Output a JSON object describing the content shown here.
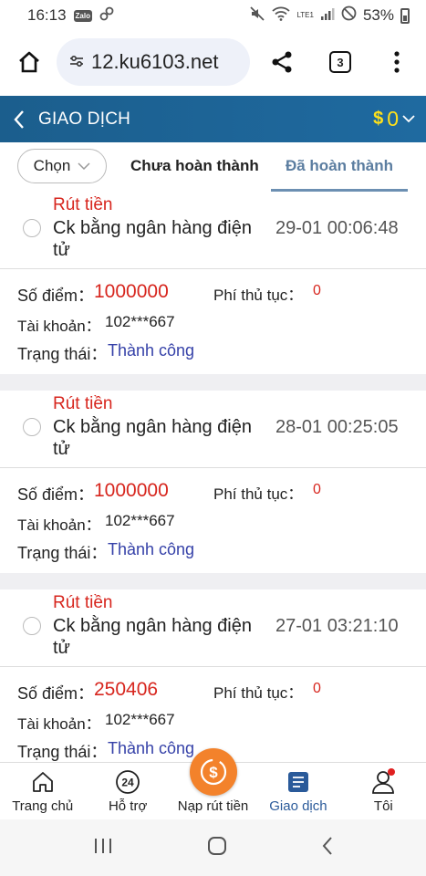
{
  "status_bar": {
    "time": "16:13",
    "zalo": "Zalo",
    "battery": "53%",
    "network": "LTE1"
  },
  "browser": {
    "url": "12.ku6103.net",
    "tab_count": "3"
  },
  "header": {
    "title": "GIAO DỊCH",
    "currency": "$",
    "balance": "0"
  },
  "tabs": {
    "select_label": "Chọn",
    "pending_label": "Chưa hoàn thành",
    "done_label": "Đã hoàn thành"
  },
  "labels": {
    "points": "Số điểm：",
    "fee": "Phí thủ tục：",
    "account": "Tài khoản：",
    "status": "Trạng thái："
  },
  "transactions": [
    {
      "type": "Rút tiền",
      "method": "Ck bằng ngân hàng điện tử",
      "time": "29-01 00:06:48",
      "points": "1000000",
      "fee": "0",
      "account": "102***667",
      "status": "Thành công"
    },
    {
      "type": "Rút tiền",
      "method": "Ck bằng ngân hàng điện tử",
      "time": "28-01 00:25:05",
      "points": "1000000",
      "fee": "0",
      "account": "102***667",
      "status": "Thành công"
    },
    {
      "type": "Rút tiền",
      "method": "Ck bằng ngân hàng điện tử",
      "time": "27-01 03:21:10",
      "points": "250406",
      "fee": "0",
      "account": "102***667",
      "status": "Thành công"
    }
  ],
  "bottom_nav": [
    {
      "label": "Trang chủ",
      "icon": "home-icon"
    },
    {
      "label": "Hỗ trợ",
      "icon": "support-24-icon"
    },
    {
      "label": "Nạp rút tiền",
      "icon": "deposit-withdraw-icon"
    },
    {
      "label": "Giao dịch",
      "icon": "transactions-icon"
    },
    {
      "label": "Tôi",
      "icon": "profile-icon"
    }
  ],
  "colors": {
    "header_bg": "#1b5e8d",
    "accent_red": "#d7261e",
    "balance_yellow": "#ffe11a",
    "active_blue": "#2a5a9a",
    "fab_orange": "#f3822b"
  }
}
